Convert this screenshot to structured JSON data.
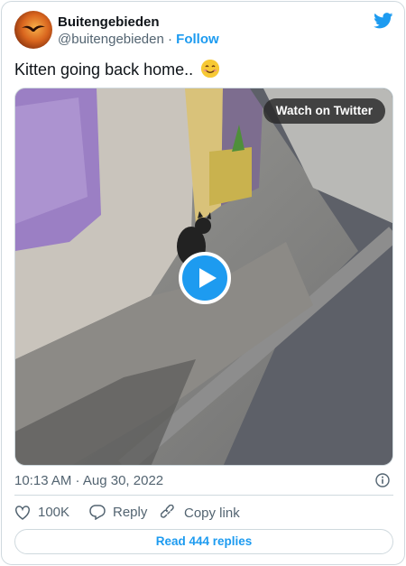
{
  "author": {
    "name": "Buitengebieden",
    "handle": "@buitengebieden",
    "separator": "·",
    "follow_label": "Follow"
  },
  "tweet": {
    "text": "Kitten going back home..",
    "emoji": "smiling-face-emoji",
    "timestamp": "10:13 AM · Aug 30, 2022"
  },
  "media": {
    "watch_label": "Watch on Twitter",
    "content": "video-thumbnail"
  },
  "actions": {
    "likes": "100K",
    "reply_label": "Reply",
    "copy_link_label": "Copy link",
    "read_replies_label": "Read 444 replies"
  },
  "colors": {
    "accent": "#1d9bf0",
    "text": "#0f1419",
    "muted": "#536471",
    "border": "#cfd9de"
  },
  "icons": [
    "twitter-bird-icon",
    "play-icon",
    "info-icon",
    "heart-icon",
    "reply-icon",
    "link-icon"
  ]
}
